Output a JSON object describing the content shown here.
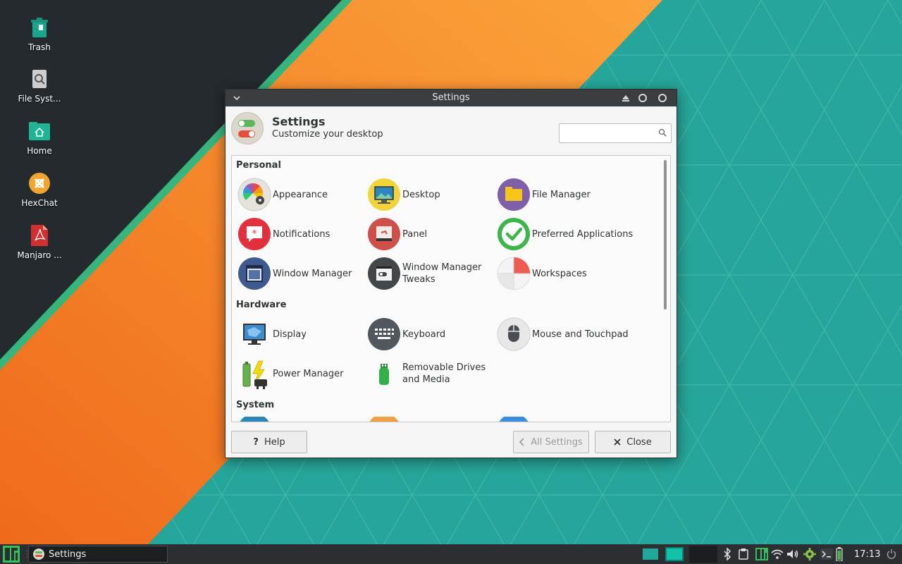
{
  "desktop": {
    "icons": [
      {
        "label": "Trash",
        "icon": "trash-icon"
      },
      {
        "label": "File Syst...",
        "icon": "file-system-icon"
      },
      {
        "label": "Home",
        "icon": "home-folder-icon"
      },
      {
        "label": "HexChat",
        "icon": "hexchat-icon"
      },
      {
        "label": "Manjaro ...",
        "icon": "pdf-document-icon"
      }
    ]
  },
  "window": {
    "title": "Settings",
    "header": {
      "title": "Settings",
      "subtitle": "Customize your desktop"
    },
    "search": {
      "placeholder": "",
      "value": ""
    },
    "sections": [
      {
        "title": "Personal",
        "items": [
          {
            "label": "Appearance",
            "icon": "appearance-icon"
          },
          {
            "label": "Desktop",
            "icon": "desktop-icon"
          },
          {
            "label": "File Manager",
            "icon": "file-manager-icon"
          },
          {
            "label": "Notifications",
            "icon": "notifications-icon"
          },
          {
            "label": "Panel",
            "icon": "panel-icon"
          },
          {
            "label": "Preferred Applications",
            "icon": "preferred-applications-icon"
          },
          {
            "label": "Window Manager",
            "icon": "window-manager-icon"
          },
          {
            "label": "Window Manager Tweaks",
            "icon": "window-manager-tweaks-icon"
          },
          {
            "label": "Workspaces",
            "icon": "workspaces-icon"
          }
        ]
      },
      {
        "title": "Hardware",
        "items": [
          {
            "label": "Display",
            "icon": "display-icon"
          },
          {
            "label": "Keyboard",
            "icon": "keyboard-icon"
          },
          {
            "label": "Mouse and Touchpad",
            "icon": "mouse-icon"
          },
          {
            "label": "Power Manager",
            "icon": "power-manager-icon"
          },
          {
            "label": "Removable Drives and Media",
            "icon": "removable-drive-icon"
          }
        ]
      },
      {
        "title": "System",
        "items": []
      }
    ],
    "buttons": {
      "help": "Help",
      "all_settings": "All Settings",
      "close": "Close"
    }
  },
  "taskbar": {
    "task_label": "Settings",
    "clock": "17:13",
    "tray_icons": [
      "bluetooth-icon",
      "clipboard-icon",
      "manjaro-icon",
      "wifi-icon",
      "volume-icon",
      "settings-gear-icon",
      "terminal-icon",
      "battery-icon"
    ]
  },
  "colors": {
    "desktop_teal": "#26a69a",
    "accent_orange": "#f57c1f",
    "stripe_green": "#35b67e",
    "dark_corner": "#252a2e",
    "titlebar": "#3b3e40",
    "taskbar": "#2b2f31"
  }
}
